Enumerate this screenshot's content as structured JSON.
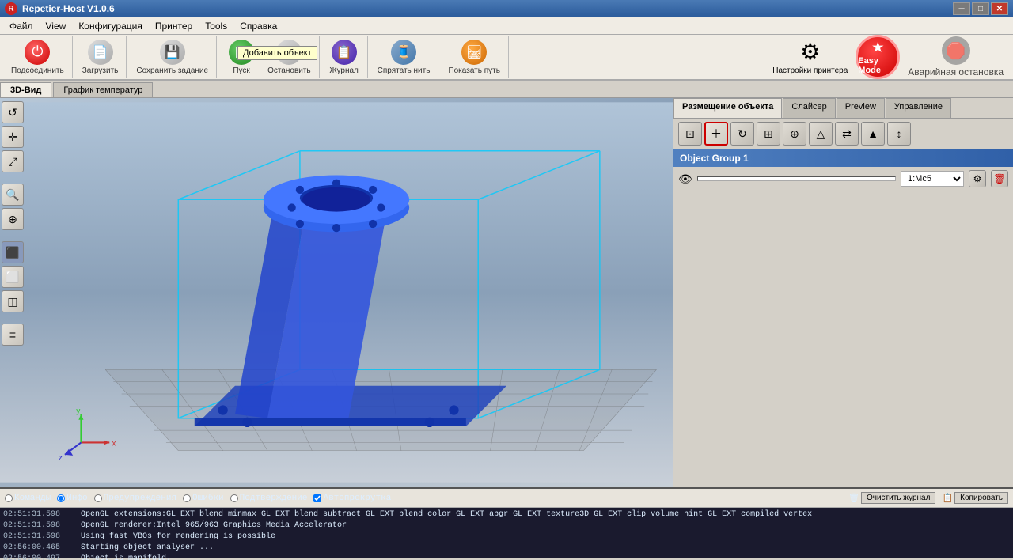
{
  "titlebar": {
    "title": "Repetier-Host V1.0.6",
    "logo": "R"
  },
  "menubar": {
    "items": [
      "Файл",
      "View",
      "Конфигурация",
      "Принтер",
      "Tools",
      "Справка"
    ]
  },
  "toolbar": {
    "connect_label": "Подсоединить",
    "load_label": "Загрузить",
    "save_label": "Сохранить задание",
    "start_label": "Пуск",
    "stop_label": "Остановить",
    "journal_label": "Журнал",
    "hide_thread_label": "Спрятать нить",
    "show_path_label": "Показать путь",
    "settings_label": "Настройки принтера",
    "easy_mode_label": "Easy Mode",
    "emergency_label": "Аварийная остановка"
  },
  "tabs": {
    "view_3d": "3D-Вид",
    "temp_graph": "График температур"
  },
  "right_panel": {
    "tabs": [
      "Размещение объекта",
      "Слайсер",
      "Preview",
      "Управление"
    ],
    "active_tab": "Размещение объекта",
    "object_group_label": "Object Group 1",
    "add_object_label": "Добавить объект",
    "printer_select": "1:Mc5"
  },
  "log": {
    "filter_labels": [
      "Команды",
      "Инфо",
      "Предупреждения",
      "Ошибки",
      "Подтверждение",
      "Автопрокрутка"
    ],
    "clear_label": "Очистить журнал",
    "copy_label": "Копировать",
    "lines": [
      {
        "time": "02:51:31.598",
        "text": "OpenGL extensions:GL_EXT_blend_minmax GL_EXT_blend_subtract GL_EXT_blend_color GL_EXT_abgr GL_EXT_texture3D GL_EXT_clip_volume_hint GL_EXT_compiled_vertex_"
      },
      {
        "time": "02:51:31.598",
        "text": "OpenGL renderer:Intel 965/963 Graphics Media Accelerator"
      },
      {
        "time": "02:51:31.598",
        "text": "Using fast VBOs for rendering is possible"
      },
      {
        "time": "02:56:00.465",
        "text": "Starting object analyser ..."
      },
      {
        "time": "02:56:00.497",
        "text": "Object is manifold."
      }
    ]
  },
  "icons": {
    "refresh": "↺",
    "move": "✛",
    "scale": "⤢",
    "zoom_in": "🔍",
    "zoom_fit": "⊕",
    "cube": "⬛",
    "cube_front": "⬜",
    "cube_side": "◫",
    "lines": "≡",
    "eye": "👁",
    "gear": "⚙",
    "delete": "🗑",
    "plus": "＋",
    "camera": "⊡",
    "rotate": "↻",
    "grid": "⊞",
    "crosshair": "⊕",
    "cone": "△",
    "flip": "⇄",
    "lamp": "▲",
    "arrow": "↕"
  }
}
